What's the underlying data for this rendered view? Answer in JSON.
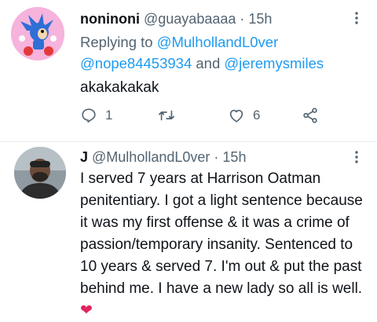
{
  "tweet1": {
    "name": "noninoni",
    "handle": "@guayabaaaa",
    "dot": "·",
    "time": "15h",
    "reply_prefix": "Replying to",
    "reply_to_1": "@MulhollandL0ver",
    "reply_to_2": "@nope84453934",
    "reply_and": "and",
    "reply_to_3": "@jeremysmiles",
    "text": "akakakakak",
    "reply_count": "1",
    "like_count": "6"
  },
  "tweet2": {
    "name": "J",
    "handle": "@MulhollandL0ver",
    "dot": "·",
    "time": "15h",
    "text": "I served 7 years at Harrison Oatman penitentiary. I got a light sentence because it was my first offense & it was a crime of passion/temporary insanity. Sentenced to 10 years & served 7. I'm out & put the past behind me. I have a new lady so all is well.",
    "emoji": "❤"
  },
  "colors": {
    "text_primary": "#0f1419",
    "text_secondary": "#536471",
    "link": "#1d9bf0",
    "heart": "#e0245e",
    "divider": "#e6ecf0"
  },
  "icons": [
    "more-icon",
    "reply-icon",
    "retweet-icon",
    "like-icon",
    "share-icon"
  ]
}
